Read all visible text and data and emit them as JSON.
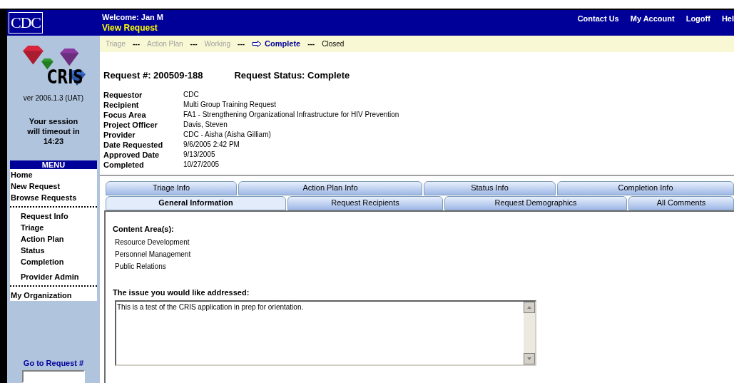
{
  "header": {
    "logo": "CDC",
    "welcome": "Welcome: Jan M",
    "page_title": "View Request",
    "links": [
      "Contact Us",
      "My Account",
      "Logoff",
      "Hel"
    ]
  },
  "workflow": {
    "steps": [
      {
        "label": "Triage",
        "selected": false,
        "disabled": true
      },
      {
        "label": "Action Plan",
        "selected": false,
        "disabled": true
      },
      {
        "label": "Working",
        "selected": false,
        "disabled": true
      },
      {
        "label": "Complete",
        "selected": true,
        "disabled": false
      },
      {
        "label": "Closed",
        "selected": false,
        "disabled": false
      }
    ],
    "separators": [
      "---",
      "---",
      "---",
      "---"
    ]
  },
  "sidebar": {
    "logo_text": "CRIS",
    "version": "ver 2006.1.3 (UAT)",
    "session": "Your session will timeout in 14:23",
    "menu_title": "MENU",
    "menu": [
      {
        "label": "Home",
        "kind": "top"
      },
      {
        "label": "New Request",
        "kind": "top"
      },
      {
        "label": "Browse Requests",
        "kind": "top"
      },
      {
        "kind": "divider"
      },
      {
        "label": "Request Info",
        "kind": "sub"
      },
      {
        "label": "Triage",
        "kind": "sub"
      },
      {
        "label": "Action Plan",
        "kind": "sub"
      },
      {
        "label": "Status",
        "kind": "sub"
      },
      {
        "label": "Completion",
        "kind": "sub"
      },
      {
        "label": "Provider Admin",
        "kind": "subgap"
      },
      {
        "kind": "divider"
      },
      {
        "label": "My Organization",
        "kind": "top"
      }
    ],
    "goto_label": "Go to Request #"
  },
  "request": {
    "number": "Request #: 200509-188",
    "status": "Request Status: Complete",
    "details": [
      {
        "label": "Requestor",
        "value": "CDC"
      },
      {
        "label": "Recipient",
        "value": "Multi Group Training Request"
      },
      {
        "label": "Focus Area",
        "value": "FA1 - Strengthening Organizational Infrastructure for HIV Prevention"
      },
      {
        "label": "Project Officer",
        "value": "Davis, Steven"
      },
      {
        "label": "Provider",
        "value": "CDC - Aisha (Aisha Gilliam)"
      },
      {
        "label": "Date Requested",
        "value": "9/6/2005 2:42 PM"
      },
      {
        "label": "Approved Date",
        "value": "9/13/2005"
      },
      {
        "label": "Completed",
        "value": "10/27/2005"
      }
    ]
  },
  "tabs": {
    "back_row": [
      {
        "label": "Triage Info",
        "selected": false
      },
      {
        "label": "Action Plan Info",
        "selected": false
      },
      {
        "label": "Status Info",
        "selected": false
      },
      {
        "label": "Completion Info",
        "selected": false
      }
    ],
    "front_row": [
      {
        "label": "General Information",
        "selected": true
      },
      {
        "label": "Request Recipients",
        "selected": false
      },
      {
        "label": "Request Demographics",
        "selected": false
      },
      {
        "label": "All Comments",
        "selected": false
      }
    ]
  },
  "panel": {
    "content_heading": "Content Area(s):",
    "content_areas": [
      "Resource Development",
      "Personnel Management",
      "Public Relations"
    ],
    "issue_heading": "The issue you would like addressed:",
    "issue_text": "This is a test of the CRIS application in prep for orientation."
  }
}
